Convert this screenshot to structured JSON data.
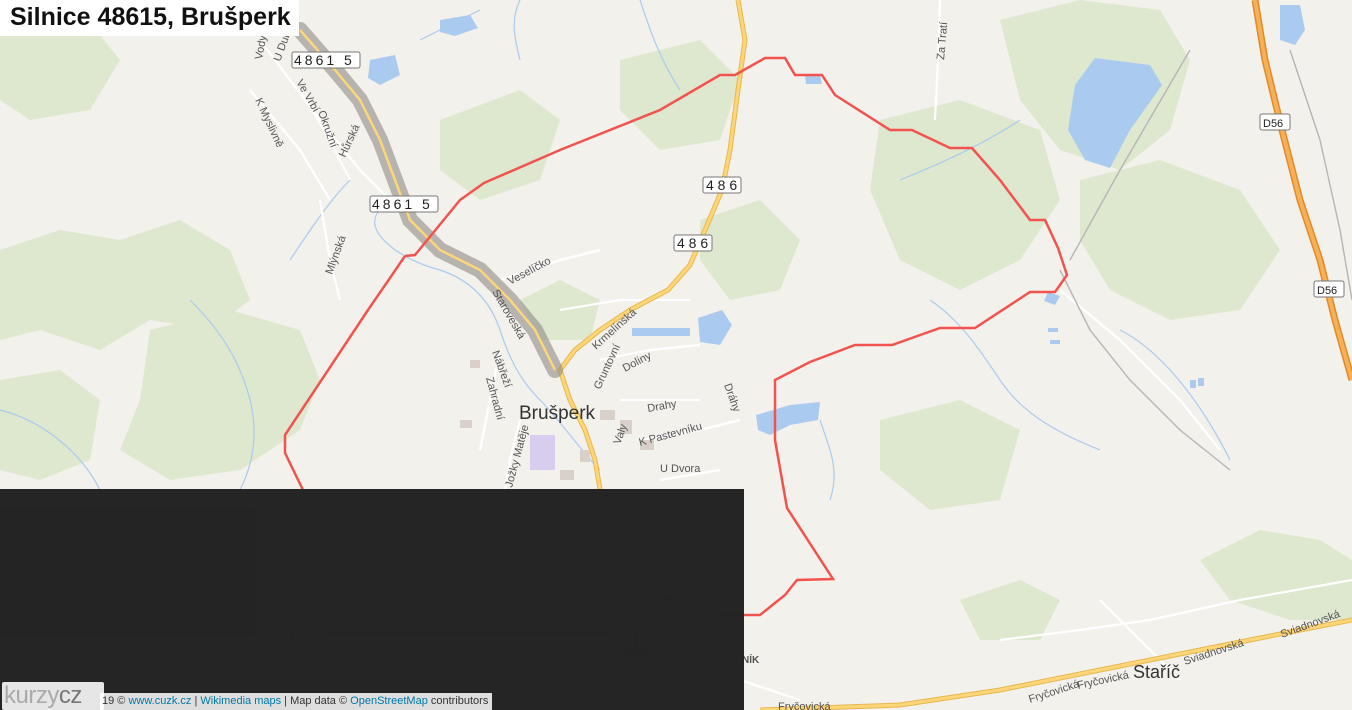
{
  "title": "Silnice 48615, Brušperk",
  "map": {
    "route_color": "#ff2b2b",
    "highlight_color": "#999999",
    "water_color": "#aacbef",
    "forest_color": "#d9e6c9",
    "background_color": "#f3f1ec",
    "road_shields": [
      "4861 5",
      "4861 5",
      "4 8 6",
      "4 8 6",
      "D56",
      "D56"
    ],
    "towns": {
      "brusperk": "Brušperk",
      "staric": "Staříč"
    },
    "streets": {
      "u_dubu": "U Dubu",
      "vody": "Vody",
      "ve_vrbi": "Ve Vrbí",
      "okruzni": "Okružní",
      "k_myslivne": "K Myslivně",
      "hurska": "Hůrská",
      "mlynska": "Mlýnská",
      "velicko": "Veselíčko",
      "starovesk": "Staroveská",
      "nabrezi": "Nábřeží",
      "zahradni": "Zahradní",
      "jozky_mateje": "Jožky Matěje",
      "krmelinska": "Krmelínská",
      "gruntovni": "Gruntovní",
      "doliny": "Doliny",
      "valy": "Valy",
      "drahy": "Drahy",
      "drahy2": "Dráhy",
      "k_pastevniku": "K Pastevníku",
      "u_dvora": "U Dvora",
      "za_trati": "Za Tratí",
      "sviadnovska": "Sviadnovská",
      "sviadnovska2": "Sviadnovská",
      "frycovicka": "Fryčovická",
      "frycovicka2": "Fryčovická",
      "frycovicka3": "Fryčovická",
      "nik": "NÍK"
    }
  },
  "attribution": {
    "prefix": "19 © ",
    "cuzk": "www.cuzk.cz",
    "sep1": " | ",
    "wikimedia": "Wikimedia maps",
    "sep2": " | Map data © ",
    "osm": "OpenStreetMap",
    "suffix": " contributors"
  },
  "logo": {
    "part1": "kurzy",
    "part2": "cz"
  }
}
